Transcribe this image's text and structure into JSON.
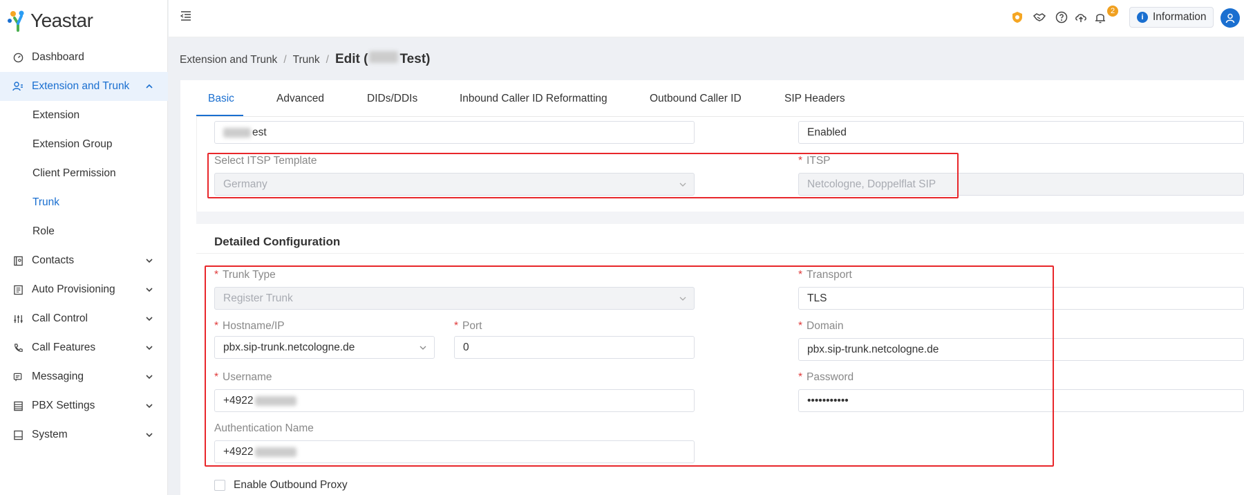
{
  "brand": {
    "name": "Yeastar"
  },
  "sidebar": {
    "items": [
      {
        "label": "Dashboard",
        "icon": "dashboard-icon"
      },
      {
        "label": "Extension and Trunk",
        "icon": "users-icon",
        "expanded": true
      },
      {
        "label": "Contacts",
        "icon": "contacts-icon"
      },
      {
        "label": "Auto Provisioning",
        "icon": "provisioning-icon"
      },
      {
        "label": "Call Control",
        "icon": "sliders-icon"
      },
      {
        "label": "Call Features",
        "icon": "phone-icon"
      },
      {
        "label": "Messaging",
        "icon": "message-icon"
      },
      {
        "label": "PBX Settings",
        "icon": "settings-icon"
      },
      {
        "label": "System",
        "icon": "system-icon"
      }
    ],
    "subitems": [
      {
        "label": "Extension"
      },
      {
        "label": "Extension Group"
      },
      {
        "label": "Client Permission"
      },
      {
        "label": "Trunk",
        "active": true
      },
      {
        "label": "Role"
      }
    ]
  },
  "topbar": {
    "notification_count": "2",
    "information_label": "Information"
  },
  "breadcrumb": {
    "level1": "Extension and Trunk",
    "level2": "Trunk",
    "current_prefix": "Edit (",
    "current_suffix": "Test)"
  },
  "tabs": [
    "Basic",
    "Advanced",
    "DIDs/DDIs",
    "Inbound Caller ID Reformatting",
    "Outbound Caller ID",
    "SIP Headers"
  ],
  "basic": {
    "name_value_suffix": "est",
    "status_value": "Enabled",
    "itsp_template_label": "Select ITSP Template",
    "itsp_template_value": "Germany",
    "itsp_label": "ITSP",
    "itsp_value": "Netcologne, Doppelflat SIP"
  },
  "detailed": {
    "title": "Detailed Configuration",
    "trunk_type_label": "Trunk Type",
    "trunk_type_value": "Register Trunk",
    "transport_label": "Transport",
    "transport_value": "TLS",
    "hostname_label": "Hostname/IP",
    "hostname_value": "pbx.sip-trunk.netcologne.de",
    "port_label": "Port",
    "port_value": "0",
    "domain_label": "Domain",
    "domain_value": "pbx.sip-trunk.netcologne.de",
    "username_label": "Username",
    "username_value": "+4922",
    "password_label": "Password",
    "password_value": "•••••••••••",
    "auth_name_label": "Authentication Name",
    "auth_name_value": "+4922",
    "outbound_proxy_label": "Enable Outbound Proxy"
  },
  "colors": {
    "accent": "#1a6fd0",
    "required": "#e03a3a",
    "highlight_box": "#e8262a"
  }
}
